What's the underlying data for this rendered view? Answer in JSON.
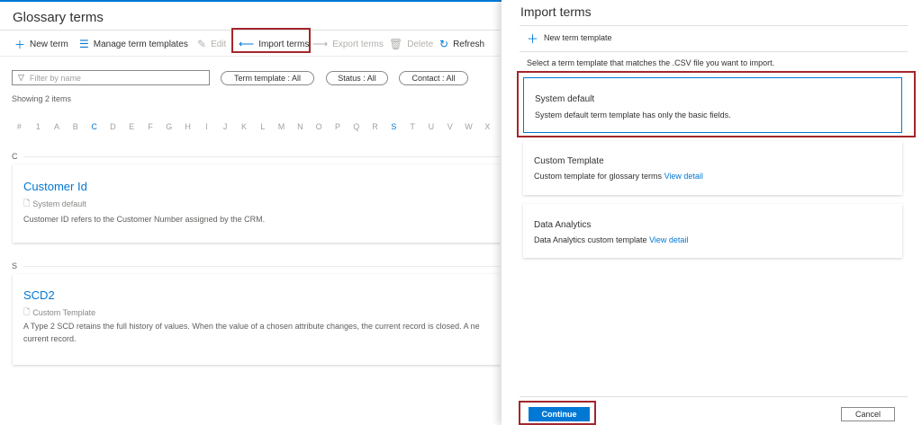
{
  "left": {
    "title": "Glossary terms",
    "toolbar": {
      "new_term": "New term",
      "manage_templates": "Manage term templates",
      "edit": "Edit",
      "import_terms": "Import terms",
      "export_terms": "Export terms",
      "delete": "Delete",
      "refresh": "Refresh"
    },
    "filter_placeholder": "Filter by name",
    "pills": {
      "term_template": "Term template : All",
      "status": "Status : All",
      "contact": "Contact : All"
    },
    "showing": "Showing 2 items",
    "alphabet": [
      "#",
      "1",
      "A",
      "B",
      "C",
      "D",
      "E",
      "F",
      "G",
      "H",
      "I",
      "J",
      "K",
      "L",
      "M",
      "N",
      "O",
      "P",
      "Q",
      "R",
      "S",
      "T",
      "U",
      "V",
      "W",
      "X"
    ],
    "active_letters": [
      "C",
      "S"
    ],
    "sections": [
      {
        "letter": "C",
        "term": "Customer Id",
        "template": "System default",
        "description": "Customer ID refers to the Customer Number assigned by the CRM."
      },
      {
        "letter": "S",
        "term": "SCD2",
        "template": "Custom Template",
        "description": "A Type 2 SCD retains the full history of values. When the value of a chosen attribute changes, the current record is closed. A ne",
        "description_line2": "current record."
      }
    ]
  },
  "panel": {
    "title": "Import terms",
    "new_template": "New term template",
    "instruction": "Select a term template that matches the .CSV file you want to import.",
    "options": [
      {
        "title": "System default",
        "desc": "System default term template has only the basic fields.",
        "link": ""
      },
      {
        "title": "Custom Template",
        "desc": "Custom template for glossary terms",
        "link": "View detail"
      },
      {
        "title": "Data Analytics",
        "desc": "Data Analytics custom template",
        "link": "View detail"
      }
    ],
    "continue": "Continue",
    "cancel": "Cancel"
  },
  "colors": {
    "accent": "#0078d4",
    "highlight": "#a4262c"
  }
}
